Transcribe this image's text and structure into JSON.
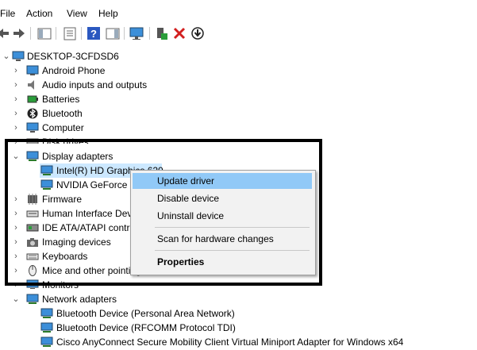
{
  "menu": {
    "file": "File",
    "action": "Action",
    "view": "View",
    "help": "Help"
  },
  "toolbar": {
    "icons": [
      "back-icon",
      "forward-icon",
      "show-hide-console-tree-icon",
      "properties-icon",
      "help-icon",
      "action-pane-icon",
      "monitor-icon",
      "add-driver-icon",
      "uninstall-device-icon",
      "update-driver-icon"
    ]
  },
  "tree": {
    "root": "DESKTOP-3CFDSD6",
    "android": "Android Phone",
    "audio": "Audio inputs and outputs",
    "batteries": "Batteries",
    "bluetooth": "Bluetooth",
    "computer": "Computer",
    "disk": "Disk drives",
    "display": "Display adapters",
    "intel": "Intel(R) HD Graphics 620",
    "nvidia": "NVIDIA GeForce 9",
    "firmware": "Firmware",
    "hid": "Human Interface Dev",
    "ide": "IDE ATA/ATAPI contro",
    "imaging": "Imaging devices",
    "keyboards": "Keyboards",
    "mice": "Mice and other pointing devices",
    "monitors": "Monitors",
    "network": "Network adapters",
    "bt_pan": "Bluetooth Device (Personal Area Network)",
    "bt_rfcomm": "Bluetooth Device (RFCOMM Protocol TDI)",
    "cisco": "Cisco AnyConnect Secure Mobility Client Virtual Miniport Adapter for Windows x64"
  },
  "context_menu": {
    "update": "Update driver",
    "disable": "Disable device",
    "uninstall": "Uninstall device",
    "scan": "Scan for hardware changes",
    "properties": "Properties"
  },
  "colors": {
    "highlight": "#91c9f7",
    "selection": "#cce8ff",
    "annotation_border": "#000000"
  }
}
